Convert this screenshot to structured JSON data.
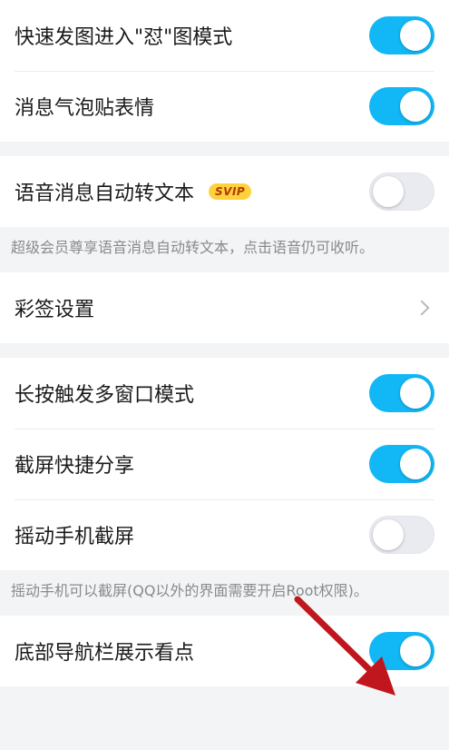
{
  "group1": {
    "items": [
      {
        "label": "快速发图进入\"怼\"图模式",
        "state": "on"
      },
      {
        "label": "消息气泡贴表情",
        "state": "on"
      }
    ]
  },
  "group2": {
    "voice": {
      "label": "语音消息自动转文本",
      "badge": "SVIP",
      "state": "off"
    },
    "note": "超级会员尊享语音消息自动转文本，点击语音仍可收听。"
  },
  "group3": {
    "item": {
      "label": "彩签设置"
    }
  },
  "group4": {
    "items": [
      {
        "label": "长按触发多窗口模式",
        "state": "on"
      },
      {
        "label": "截屏快捷分享",
        "state": "on"
      },
      {
        "label": "摇动手机截屏",
        "state": "off"
      }
    ],
    "note": "摇动手机可以截屏(QQ以外的界面需要开启Root权限)。"
  },
  "group5": {
    "item": {
      "label": "底部导航栏展示看点",
      "state": "on"
    }
  },
  "colors": {
    "accent": "#12b7f5",
    "toggle_off": "#e9ebf1",
    "annotation_arrow": "#c0161e"
  }
}
